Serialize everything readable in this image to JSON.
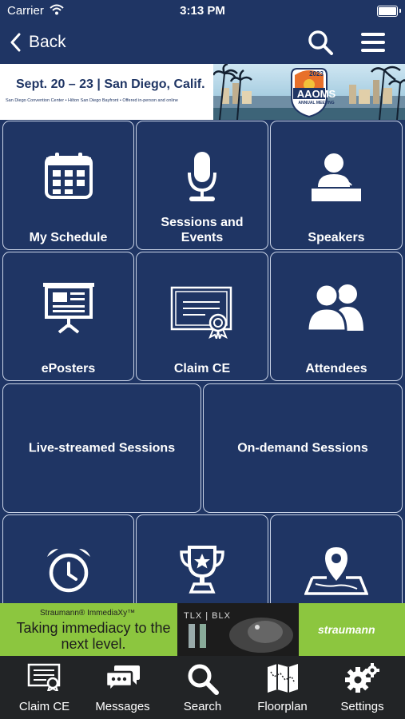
{
  "status": {
    "carrier": "Carrier",
    "time": "3:13 PM"
  },
  "nav": {
    "back_label": "Back"
  },
  "banner": {
    "dates": "Sept. 20 – 23 | San Diego, Calif.",
    "venue": "San Diego Convention Center • Hilton San Diego Bayfront • Offered in-person and online",
    "logo_year": "2023",
    "logo_text": "AAOMS",
    "logo_sub": "ANNUAL MEETING"
  },
  "tiles": {
    "my_schedule": "My Schedule",
    "sessions": "Sessions and Events",
    "speakers": "Speakers",
    "eposters": "ePosters",
    "claim_ce": "Claim CE",
    "attendees": "Attendees",
    "live": "Live-streamed Sessions",
    "ondemand": "On-demand Sessions"
  },
  "ad": {
    "brand_small": "Straumann® ImmediaXy™",
    "tagline": "Taking immediacy to the next level.",
    "models": "TLX | BLX",
    "brand_big": "straumann"
  },
  "tabbar": {
    "claim_ce": "Claim CE",
    "messages": "Messages",
    "search": "Search",
    "floorplan": "Floorplan",
    "settings": "Settings"
  },
  "colors": {
    "navy": "#1f3564",
    "tile_border": "#c9d3e6",
    "ad_green": "#8cc63f",
    "tabbar": "#222426"
  }
}
